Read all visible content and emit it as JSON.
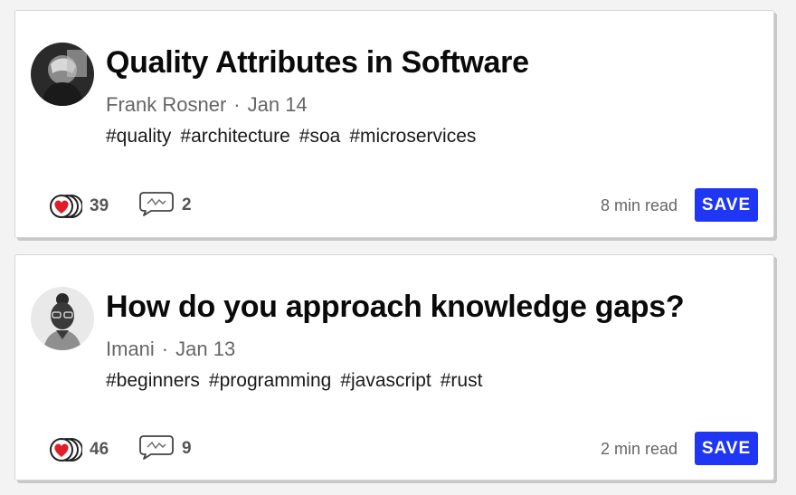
{
  "colors": {
    "accent": "#1f36f5",
    "heart": "#e11d2a",
    "text": "#0a0a0a",
    "muted": "#666666"
  },
  "icons": {
    "reactions": "heart-stack-icon",
    "comments": "comment-bubble-icon"
  },
  "articles": [
    {
      "title": "Quality Attributes in Software",
      "author": "Frank Rosner",
      "separator": "·",
      "date": "Jan 14",
      "tags": [
        "#quality",
        "#architecture",
        "#soa",
        "#microservices"
      ],
      "reactions": "39",
      "comments": "2",
      "read_time": "8 min read",
      "save_label": "SAVE"
    },
    {
      "title": "How do you approach knowledge gaps?",
      "author": "Imani",
      "separator": "·",
      "date": "Jan 13",
      "tags": [
        "#beginners",
        "#programming",
        "#javascript",
        "#rust"
      ],
      "reactions": "46",
      "comments": "9",
      "read_time": "2 min read",
      "save_label": "SAVE"
    }
  ]
}
